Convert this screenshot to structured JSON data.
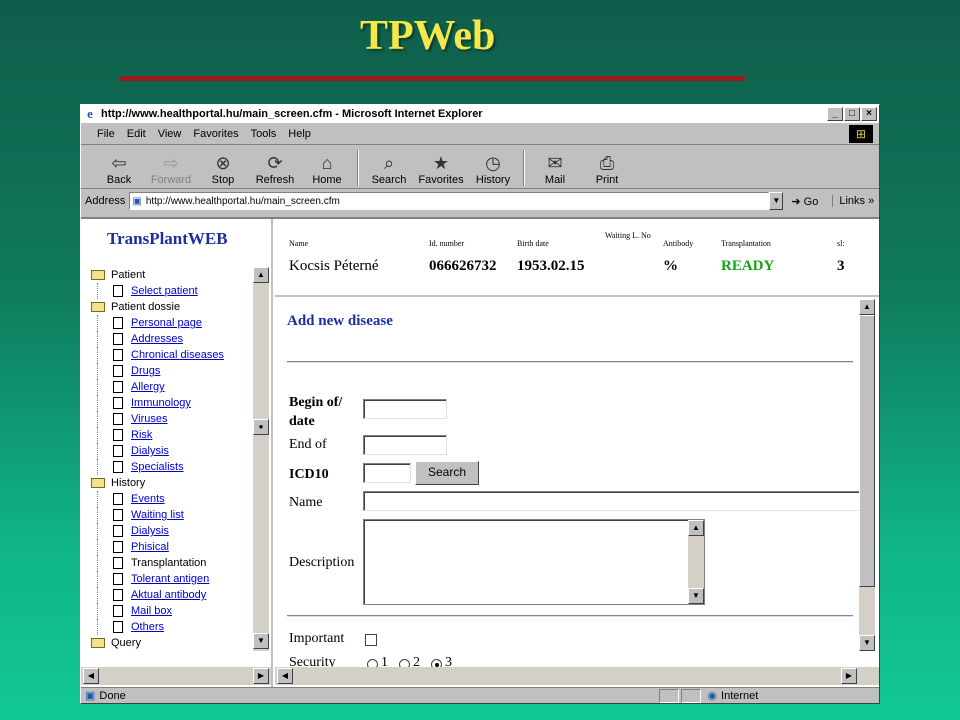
{
  "slide": {
    "title": "TPWeb"
  },
  "browser": {
    "title": "http://www.healthportal.hu/main_screen.cfm - Microsoft Internet Explorer",
    "menu": [
      "File",
      "Edit",
      "View",
      "Favorites",
      "Tools",
      "Help"
    ],
    "toolbar": {
      "back": "Back",
      "forward": "Forward",
      "stop": "Stop",
      "refresh": "Refresh",
      "home": "Home",
      "search": "Search",
      "favorites": "Favorites",
      "history": "History",
      "mail": "Mail",
      "print": "Print"
    },
    "address_label": "Address",
    "address_value": "http://www.healthportal.hu/main_screen.cfm",
    "go": "Go",
    "links": "Links",
    "status": "Done",
    "zone": "Internet"
  },
  "app": {
    "logo": "TransPlantWEB",
    "tree": [
      {
        "type": "folder",
        "label": "Patient",
        "link": false
      },
      {
        "type": "doc",
        "label": "Select patient",
        "link": true
      },
      {
        "type": "folder",
        "label": "Patient dossie",
        "link": false
      },
      {
        "type": "doc",
        "label": "Personal page",
        "link": true
      },
      {
        "type": "doc",
        "label": "Addresses",
        "link": true
      },
      {
        "type": "doc",
        "label": "Chronical diseases",
        "link": true
      },
      {
        "type": "doc",
        "label": "Drugs",
        "link": true
      },
      {
        "type": "doc",
        "label": "Allergy",
        "link": true
      },
      {
        "type": "doc",
        "label": "Immunology",
        "link": true
      },
      {
        "type": "doc",
        "label": "Viruses",
        "link": true
      },
      {
        "type": "doc",
        "label": "Risk",
        "link": true
      },
      {
        "type": "doc",
        "label": "Dialysis",
        "link": true
      },
      {
        "type": "doc",
        "label": "Specialists",
        "link": true
      },
      {
        "type": "folder",
        "label": "History",
        "link": false
      },
      {
        "type": "doc",
        "label": "Events",
        "link": true
      },
      {
        "type": "doc",
        "label": "Waiting list",
        "link": true
      },
      {
        "type": "doc",
        "label": "Dialysis",
        "link": true
      },
      {
        "type": "doc",
        "label": "Phisical",
        "link": true
      },
      {
        "type": "doc",
        "label": "Transplantation",
        "link": false
      },
      {
        "type": "doc",
        "label": "Tolerant antigen",
        "link": true
      },
      {
        "type": "doc",
        "label": "Aktual antibody",
        "link": true
      },
      {
        "type": "doc",
        "label": "Mail box",
        "link": true
      },
      {
        "type": "doc",
        "label": "Others",
        "link": true
      },
      {
        "type": "folder",
        "label": "Query",
        "link": false
      }
    ],
    "header": {
      "name_h": "Name",
      "name_v": "Kocsis Péterné",
      "id_h": "Id. number",
      "id_v": "066626732",
      "birth_h": "Birth date",
      "birth_v": "1953.02.15",
      "waiting_h": "Waiting L. No",
      "waiting_v": "",
      "antibody_h": "Antibody",
      "antibody_v": "%",
      "tx_h": "Transplantation",
      "tx_v": "READY",
      "sl_h": "sl:",
      "sl_v": "3"
    },
    "form": {
      "title": "Add new disease",
      "begin_label": "Begin of/ date",
      "end_label": "End of",
      "icd_label": "ICD10",
      "search_button": "Search",
      "name_label": "Name",
      "desc_label": "Description",
      "important_label": "Important",
      "security_label": "Security",
      "security_options": [
        "1",
        "2",
        "3"
      ],
      "security_selected": "3"
    }
  },
  "colors": {
    "title": "#f4e84a",
    "rule": "#9a1b1b",
    "app_blue": "#1a2fa0",
    "ready": "#18a218"
  }
}
